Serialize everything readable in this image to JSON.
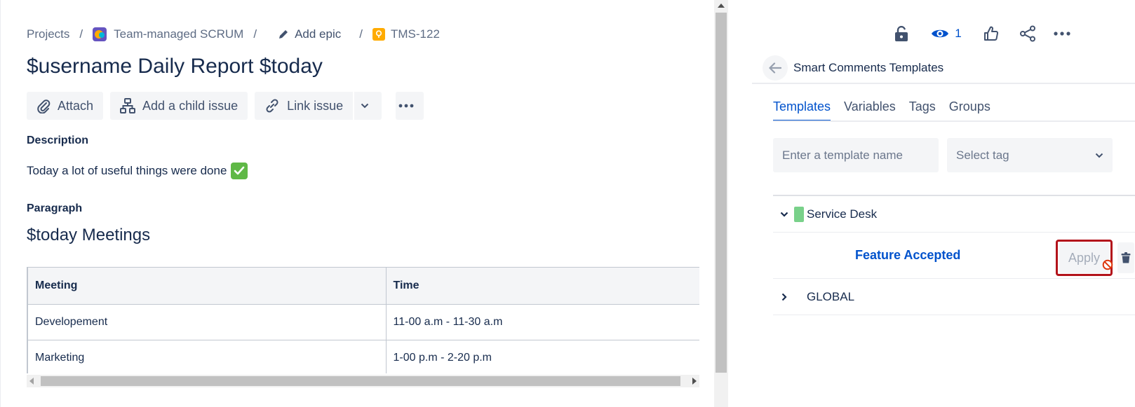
{
  "breadcrumb": {
    "projects": "Projects",
    "project_name": "Team-managed SCRUM",
    "add_epic": "Add epic",
    "issue_key": "TMS-122",
    "separator": "/"
  },
  "issue": {
    "title": "$username Daily Report $today"
  },
  "toolbar": {
    "attach": "Attach",
    "add_child": "Add a child issue",
    "link_issue": "Link issue"
  },
  "description": {
    "label": "Description",
    "text": "Today a lot of useful things were done"
  },
  "paragraph": {
    "label": "Paragraph",
    "heading": "$today Meetings"
  },
  "table": {
    "headers": [
      "Meeting",
      "Time"
    ],
    "rows": [
      [
        "Developement",
        "11-00 a.m - 11-30 a.m"
      ],
      [
        "Marketing",
        "1-00 p.m - 2-20 p.m"
      ]
    ]
  },
  "actions": {
    "watch_count": "1"
  },
  "smart_comments": {
    "title": "Smart Comments Templates",
    "tabs": [
      "Templates",
      "Variables",
      "Tags",
      "Groups"
    ],
    "active_tab": "Templates",
    "search_placeholder": "Enter a template name",
    "select_tag_placeholder": "Select tag",
    "groups": [
      {
        "name": "Service Desk",
        "expanded": true,
        "tag_color": "#79d18a",
        "templates": [
          {
            "name": "Feature Accepted",
            "apply_label": "Apply",
            "apply_enabled": false
          }
        ]
      },
      {
        "name": "GLOBAL",
        "expanded": false
      }
    ]
  },
  "colors": {
    "primary_blue": "#0052cc",
    "text_dark": "#172b4d",
    "highlight_red": "#b3131b",
    "button_bg": "#f4f5f7"
  }
}
